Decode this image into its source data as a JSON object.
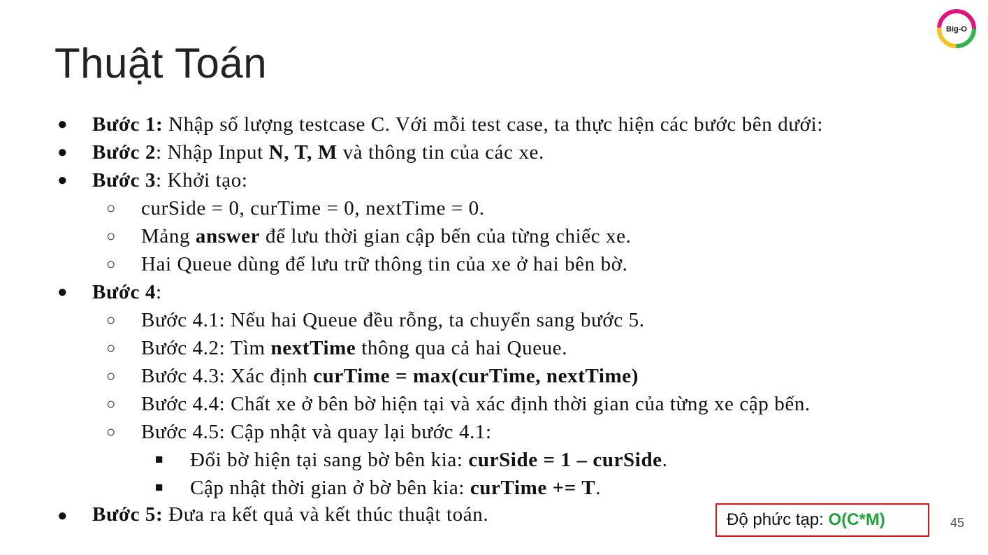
{
  "slide": {
    "title": "Thuật Toán",
    "logo_text": "Big-O",
    "page_number": "45"
  },
  "steps": [
    {
      "label": "Bước 1:",
      "text": " Nhập số lượng testcase C. Với mỗi test case, ta thực hiện các bước bên dưới:"
    },
    {
      "label": "Bước 2",
      "text_a": ": Nhập Input ",
      "bold": "N, T, M",
      "text_b": " và thông tin của các xe."
    },
    {
      "label": "Bước 3",
      "text": ": Khởi tạo:"
    },
    {
      "text": "curSide = 0, curTime = 0, nextTime = 0."
    },
    {
      "text_a": "Mảng ",
      "bold": "answer",
      "text_b": " để lưu thời gian cập bến của từng chiếc xe."
    },
    {
      "text": "Hai Queue dùng để lưu trữ thông tin của xe ở hai bên bờ."
    },
    {
      "label": "Bước 4",
      "text": ":"
    },
    {
      "text": "Bước 4.1: Nếu hai Queue đều rỗng, ta chuyển sang bước 5."
    },
    {
      "text_a": "Bước 4.2: Tìm ",
      "bold": "nextTime",
      "text_b": " thông qua cả hai Queue."
    },
    {
      "text_a": "Bước 4.3: Xác định ",
      "bold": "curTime = max(curTime, nextTime)"
    },
    {
      "text": "Bước 4.4: Chất xe ở bên bờ hiện tại và xác định thời gian của từng xe cập bến."
    },
    {
      "text": "Bước 4.5: Cập nhật và quay lại bước 4.1:"
    },
    {
      "text_a": "Đổi bờ hiện tại sang bờ bên kia: ",
      "bold": "curSide = 1 – curSide",
      "text_b": "."
    },
    {
      "text_a": "Cập nhật thời gian ở bờ bên kia: ",
      "bold": "curTime += T",
      "text_b": "."
    },
    {
      "label": "Bước 5:",
      "text": " Đưa ra kết quả và kết thúc thuật toán."
    }
  ],
  "bullets": {
    "level1": "●",
    "level2": "○",
    "level3": "■"
  },
  "complexity": {
    "label": "Độ phức tạp: ",
    "value": "O(C*M)"
  },
  "colors": {
    "box_border": "#dd1111",
    "complexity_value": "#21a33b",
    "logo_ring": [
      "#e0147a",
      "#f2c31b",
      "#2fb34a",
      "#1a1a1a"
    ]
  }
}
